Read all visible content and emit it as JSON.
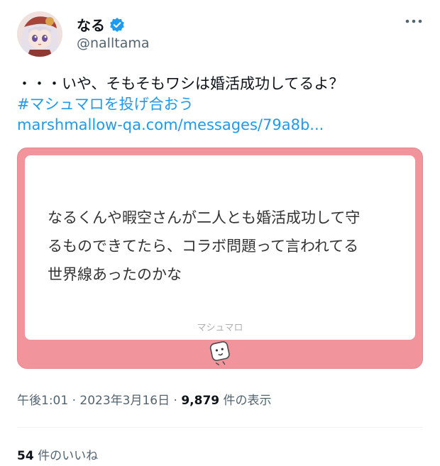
{
  "author": {
    "display_name": "なる",
    "handle": "@nalltama"
  },
  "tweet": {
    "text_line": "・・・いや、そもそもワシは婚活成功してるよ？",
    "hashtag": "#マシュマロを投げ合おう",
    "link": "marshmallow-qa.com/messages/79a8b..."
  },
  "card": {
    "question_lines": [
      "なるくんや暇空さんが二人とも婚活成功して守",
      "るものできてたら、コラボ問題って言われてる",
      "世界線あったのかな"
    ],
    "brand": "マシュマロ"
  },
  "meta": {
    "time": "午後1:01",
    "separator": "·",
    "date": "2023年3月16日",
    "views_count": "9,879",
    "views_label": "件の表示"
  },
  "likes": {
    "count": "54",
    "label": "件のいいね"
  },
  "icons": {
    "avatar": "avatar",
    "verified": "verified-badge-icon",
    "more": "more-options-icon",
    "mascot": "marshmallow-mascot-icon"
  },
  "colors": {
    "link": "#1d9bf0",
    "card_bg": "#f1949b",
    "muted": "#536471"
  }
}
